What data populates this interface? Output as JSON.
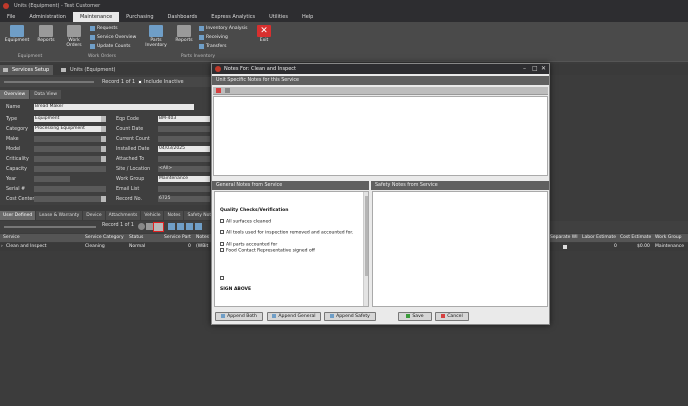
{
  "window": {
    "title": "Units (Equipment) - Test Customer"
  },
  "menu": [
    "File",
    "Administration",
    "Maintenance",
    "Purchasing",
    "Dashboards",
    "Express Analytics",
    "Utilities",
    "Help"
  ],
  "ribbon": {
    "equipment": "Equipment",
    "reports1": "Reports",
    "work_orders": "Work Orders",
    "requests": "Requests",
    "service_overview": "Service Overview",
    "update_counts": "Update Counts",
    "parts_inventory": "Parts Inventory",
    "reports2": "Reports",
    "inventory_analysis": "Inventory Analysis",
    "receiving": "Receiving",
    "transfers": "Transfers",
    "exit": "Exit",
    "group_equipment": "Equipment",
    "group_work_orders": "Work Orders",
    "group_parts_inventory": "Parts Inventory"
  },
  "doc_tabs": [
    "Services Setup",
    "Units (Equipment)"
  ],
  "record_nav": {
    "label": "Record 1 of 1",
    "include_inactive": "Include Inactive"
  },
  "view_tabs": [
    "Overview",
    "Data View"
  ],
  "form": {
    "name_label": "Name",
    "name": "Bread Maker",
    "type_label": "Type",
    "type": "Equipment",
    "category_label": "Category",
    "category": "Processing Equipment",
    "make_label": "Make",
    "model_label": "Model",
    "criticality_label": "Criticality",
    "capacity_label": "Capacity",
    "year_label": "Year",
    "serial_label": "Serial #",
    "cost_center_label": "Cost Center",
    "eqp_code_label": "Eqp Code",
    "eqp_code": "BM-403",
    "count_date_label": "Count Date",
    "current_count_label": "Current Count",
    "installed_date_label": "Installed Date",
    "installed_date": "04/03/2025",
    "attached_to_label": "Attached To",
    "site_location_label": "Site / Location",
    "site_location": "<All>",
    "work_group_label": "Work Group",
    "work_group": "Maintenance",
    "email_list_label": "Email List",
    "record_no_label": "Record No.",
    "record_no": "6725"
  },
  "grid_tabs": [
    "User Defined",
    "Lease & Warranty",
    "Device",
    "Attachments",
    "Vehicle",
    "Notes",
    "Safety Notes"
  ],
  "grid_nav": {
    "label": "Record 1 of 1"
  },
  "grid": {
    "headers": [
      "Service",
      "Service Category",
      "Status",
      "Service Part",
      "Notes"
    ],
    "right_headers": [
      "Separate WI",
      "Labor Estimate",
      "Cost Estimate",
      "Work Group"
    ],
    "row": {
      "service": "Clean and Inspect",
      "category": "Cleaning",
      "status": "Normal",
      "part": "0",
      "notes": "(WBit",
      "labor": "0",
      "cost": "$0.00",
      "group": "Maintenance"
    }
  },
  "dialog": {
    "title": "Notes For: Clean and Inspect",
    "unit_specific": "Unit Specific Notes for this Service",
    "general": "General Notes from Service",
    "safety": "Safety Notes from Service",
    "general_content": {
      "heading": "Quality Checks/Verification",
      "c1": "All surfaces cleaned",
      "c2": "All tools used for inspection removed and accounted for.",
      "c3": "All parts accounted for",
      "c4": "Food Contact Representative signed off",
      "sign": "SIGN ABOVE"
    },
    "buttons": {
      "append_both": "Append Both",
      "append_general": "Append General",
      "append_safety": "Append Safety",
      "save": "Save",
      "cancel": "Cancel"
    }
  }
}
